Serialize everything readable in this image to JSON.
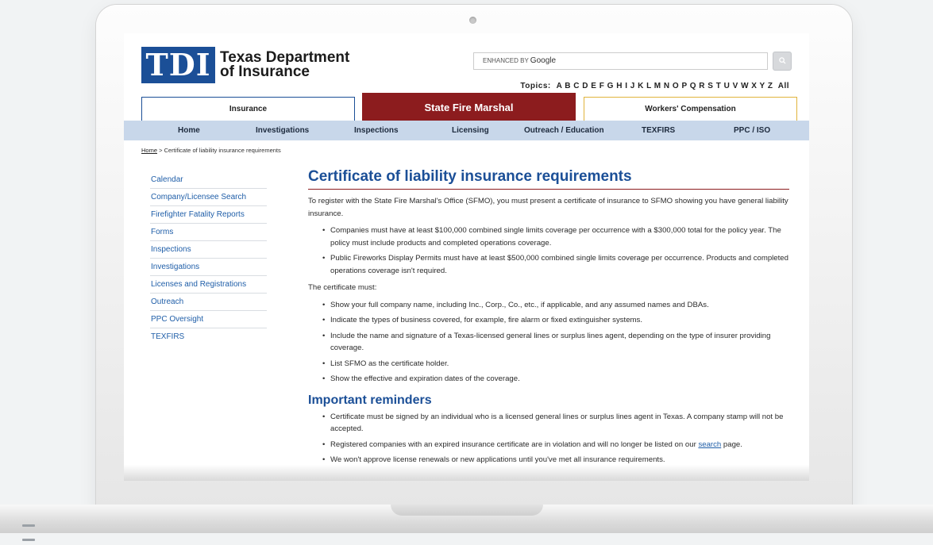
{
  "header": {
    "logo_mark": "TDI",
    "logo_line1": "Texas Department",
    "logo_line2": "of Insurance",
    "search_brand_small": "ENHANCED BY",
    "search_brand_google": "Google",
    "search_button_icon": "search-icon",
    "topics_label": "Topics:",
    "topics_letters": "A B C D E F G H I J K L M N O P Q R S T U V W X Y Z",
    "topics_all": "All"
  },
  "tabs": [
    {
      "label": "Insurance"
    },
    {
      "label": "State Fire Marshal"
    },
    {
      "label": "Workers' Compensation"
    }
  ],
  "nav": [
    {
      "label": "Home"
    },
    {
      "label": "Investigations"
    },
    {
      "label": "Inspections"
    },
    {
      "label": "Licensing"
    },
    {
      "label": "Outreach / Education"
    },
    {
      "label": "TEXFIRS"
    },
    {
      "label": "PPC / ISO"
    }
  ],
  "breadcrumb": {
    "home": "Home",
    "sep": ">",
    "current": "Certificate of liability insurance requirements"
  },
  "sidebar": [
    "Calendar",
    "Company/Licensee Search",
    "Firefighter Fatality Reports",
    "Forms",
    "Inspections",
    "Investigations",
    "Licenses and Registrations",
    "Outreach",
    "PPC Oversight",
    "TEXFIRS"
  ],
  "main": {
    "title": "Certificate of liability insurance requirements",
    "intro": "To register with the State Fire Marshal's Office (SFMO), you must present a certificate of insurance to SFMO showing you have general liability insurance.",
    "list1": [
      "Companies must have at least $100,000 combined single limits coverage per occurrence with a $300,000 total for the policy year. The policy must include products and completed operations coverage.",
      "Public Fireworks Display Permits must have at least $500,000 combined single limits coverage per occurrence. Products and completed operations coverage isn't required."
    ],
    "cert_label": "The certificate must:",
    "list2": [
      "Show your full company name, including Inc., Corp., Co., etc., if applicable, and any assumed names and DBAs.",
      "Indicate the types of business covered, for example, fire alarm or fixed extinguisher systems.",
      "Include the name and signature of a Texas-licensed general lines or surplus lines agent, depending on the type of insurer providing coverage.",
      "List SFMO as the certificate holder.",
      "Show the effective and expiration dates of the coverage."
    ],
    "reminders_title": "Important reminders",
    "reminder1": "Certificate must be signed by an individual who is a licensed general lines or surplus lines agent in Texas. A company stamp will not be accepted.",
    "reminder2_pre": "Registered companies with an expired insurance certificate are in violation and will no longer be listed on our",
    "reminder2_link": "search",
    "reminder2_post": "page.",
    "reminder3": "We won't approve license renewals or new applications until you've met all insurance requirements."
  }
}
